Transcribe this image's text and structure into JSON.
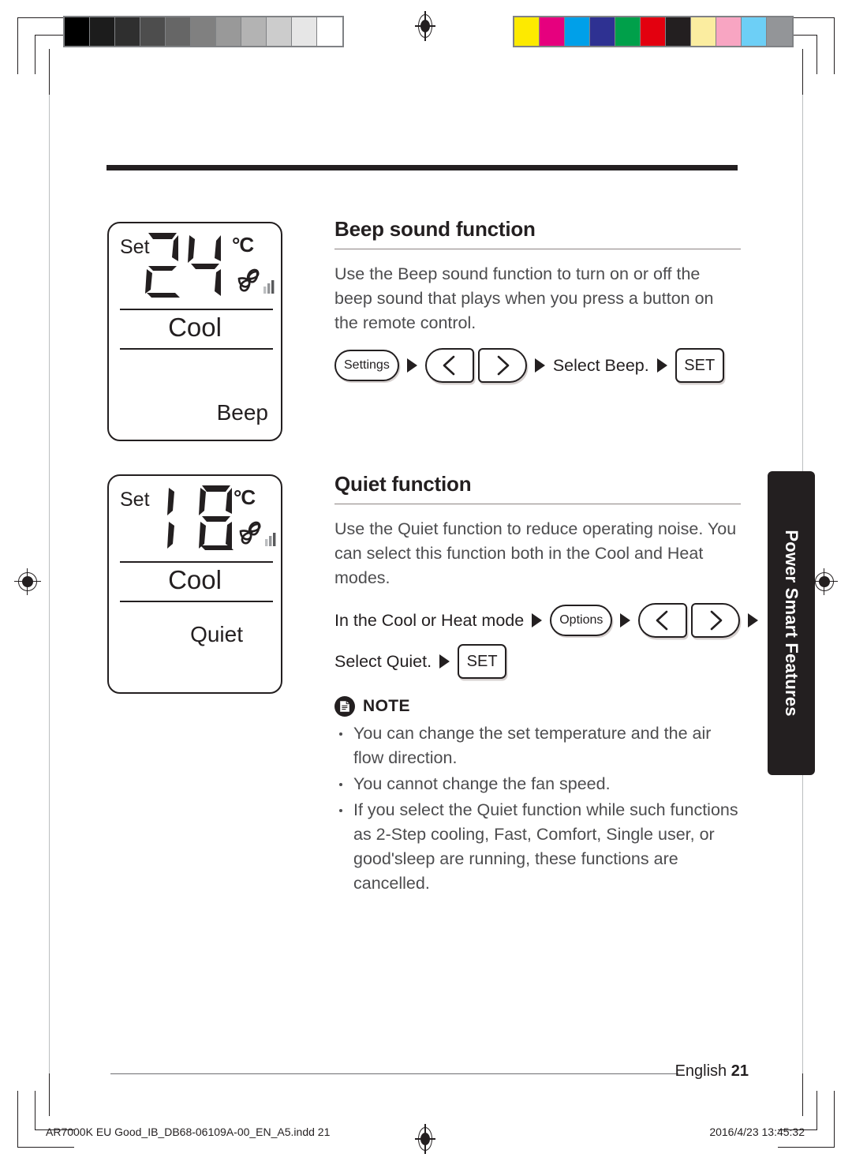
{
  "document": {
    "section_tab": "Power Smart Features",
    "footer_language": "English",
    "footer_page": "21",
    "print_file": "AR7000K EU Good_IB_DB68-06109A-00_EN_A5.indd   21",
    "print_timestamp": "2016/4/23   13:45:32"
  },
  "displays": [
    {
      "id": "beep",
      "set_label": "Set",
      "temperature": "24",
      "unit": "°C",
      "mode": "Cool",
      "status": "Beep",
      "fan_icon": "fan-icon",
      "fan_bars": 3
    },
    {
      "id": "quiet",
      "set_label": "Set",
      "temperature": "18",
      "unit": "°C",
      "mode": "Cool",
      "status": "Quiet",
      "fan_icon": "fan-icon",
      "fan_bars": 3
    }
  ],
  "sections": [
    {
      "id": "beep",
      "title": "Beep sound function",
      "body": "Use the Beep sound function to turn on or off the beep sound that plays when you press a button on the remote control.",
      "steps_row1": {
        "settings_button": "Settings",
        "select_text": "Select Beep.",
        "set_button": "SET"
      }
    },
    {
      "id": "quiet",
      "title": "Quiet function",
      "body": "Use the Quiet function to reduce operating noise. You can select this function both in the Cool and Heat modes.",
      "steps_row1": {
        "lead_text": "In the Cool or Heat mode",
        "options_button": "Options"
      },
      "steps_row2": {
        "select_text": "Select Quiet.",
        "set_button": "SET"
      }
    }
  ],
  "note": {
    "title": "NOTE",
    "icon": "document-icon",
    "items": [
      "You can change the set temperature and the air flow direction.",
      "You cannot change the fan speed.",
      "If you select the Quiet function while such functions as 2-Step cooling, Fast, Comfort, Single user, or good'sleep are running, these functions are cancelled."
    ]
  },
  "prepress": {
    "grayscale_swatches": [
      "#000000",
      "#1c1c1c",
      "#2f2f2f",
      "#4d4d4d",
      "#666666",
      "#808080",
      "#999999",
      "#b3b3b3",
      "#cccccc",
      "#e6e6e6",
      "#ffffff"
    ],
    "color_swatches": [
      "#fdea00",
      "#e6007e",
      "#00a0e9",
      "#2e3192",
      "#00a04a",
      "#e3000f",
      "#231f20",
      "#fbeda0",
      "#f8a5c2",
      "#6dcff6",
      "#939598"
    ]
  }
}
